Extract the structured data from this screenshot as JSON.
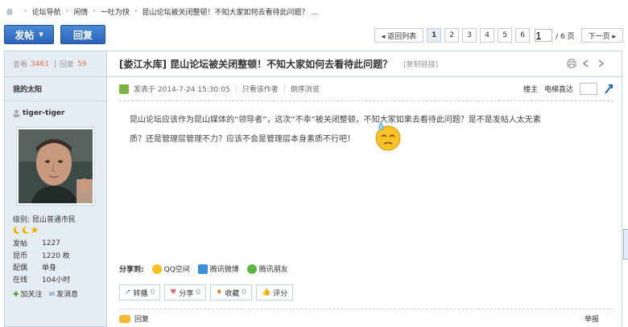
{
  "breadcrumb": {
    "items": [
      "论坛导航",
      "闲情",
      "一吐为快",
      "昆山论坛被关闭整顿！不知大家如何去看待此问题？ ..."
    ]
  },
  "toolbar": {
    "post_label": "发帖",
    "reply_label": "回复",
    "back_label": "◂ 返回列表",
    "pages": [
      "1",
      "2",
      "3",
      "4",
      "5",
      "6"
    ],
    "current_page": "1",
    "page_input": "1",
    "total": "/ 6 页",
    "next_label": "下一页 ▸"
  },
  "stats": {
    "views_label": "查看",
    "views": "3461",
    "replies_label": "回复",
    "replies": "59"
  },
  "sidebar": {
    "group_title": "我的太阳",
    "username": "tiger-tiger",
    "level": "级别: 昆山普通市民",
    "profile": [
      {
        "k": "发帖",
        "v": "1227"
      },
      {
        "k": "昆币",
        "v": "1220 枚"
      },
      {
        "k": "配偶",
        "v": "单身"
      },
      {
        "k": "在线",
        "v": "104小时"
      }
    ],
    "add_friend": "加关注",
    "send_msg": "发消息"
  },
  "post": {
    "title": "[娄江水库] 昆山论坛被关闭整顿！不知大家如何去看待此问题？",
    "copy_link": "[复制链接]",
    "published": "发表于 2014-7-24 15:30:05",
    "only_author": "只看该作者",
    "reverse": "倒序浏览",
    "floor_owner": "楼主",
    "elevator": "电梯直达",
    "content_line1": "昆山论坛应该作为昆山媒体的“领导者”，这次“不幸”被关闭整顿，不知大家如果去看待此问题？是不是发帖人太无素",
    "content_line2": "质？还是管理层管理不力？应该不会是管理层本身素质不行吧！"
  },
  "share": {
    "label": "分享到:",
    "items": [
      "QQ空间",
      "腾讯微博",
      "腾讯朋友"
    ]
  },
  "actions": [
    {
      "label": "转播",
      "count": "0"
    },
    {
      "label": "分享",
      "count": "0"
    },
    {
      "label": "收藏",
      "count": "0"
    },
    {
      "label": "评分",
      "count": ""
    }
  ],
  "footer": {
    "reply": "回复",
    "report": "举报"
  }
}
